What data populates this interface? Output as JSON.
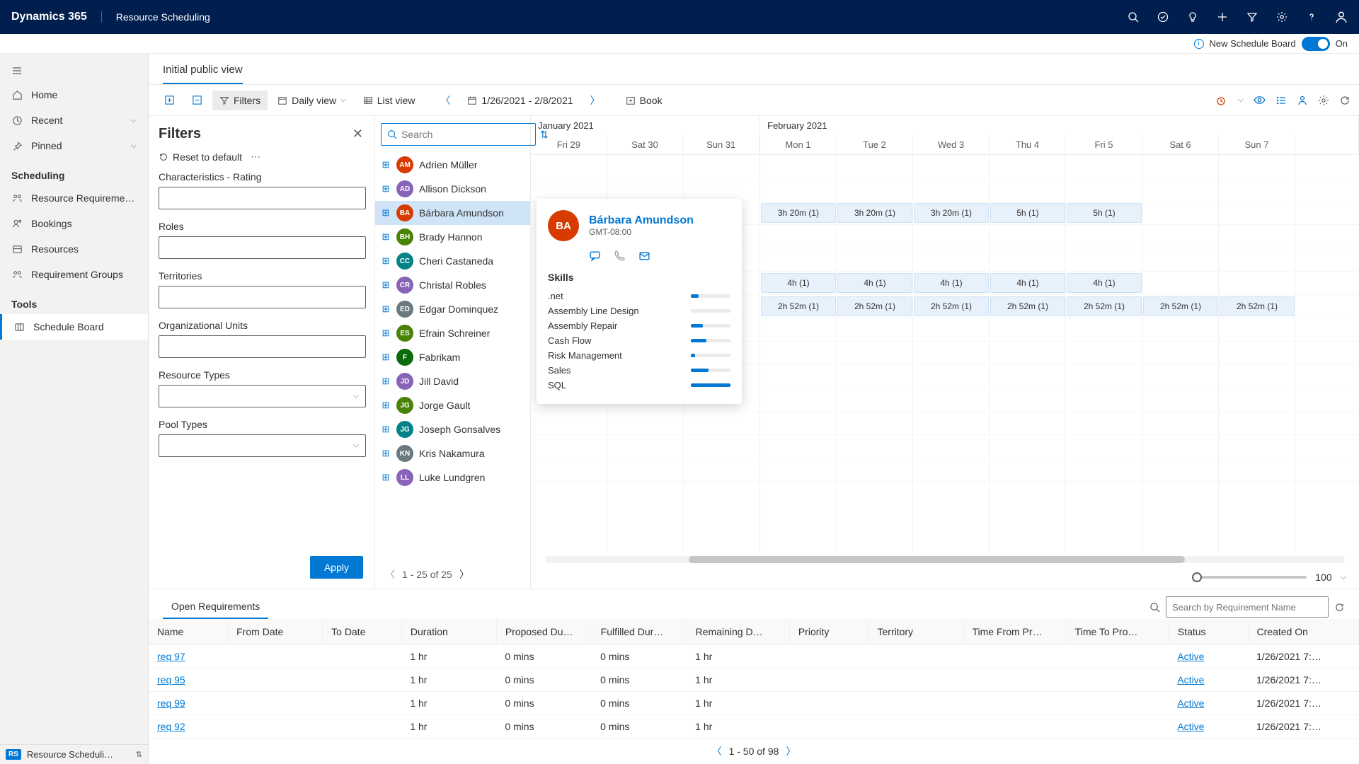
{
  "topbar": {
    "brand": "Dynamics 365",
    "module": "Resource Scheduling"
  },
  "newboard": {
    "label": "New Schedule Board",
    "state": "On"
  },
  "leftnav": {
    "home": "Home",
    "recent": "Recent",
    "pinned": "Pinned",
    "section_scheduling": "Scheduling",
    "resource_requirements": "Resource Requireme…",
    "bookings": "Bookings",
    "resources": "Resources",
    "requirement_groups": "Requirement Groups",
    "section_tools": "Tools",
    "schedule_board": "Schedule Board",
    "bottom": "Resource Scheduli…"
  },
  "viewtab": "Initial public view",
  "toolbar": {
    "filters": "Filters",
    "daily_view": "Daily view",
    "list_view": "List view",
    "date_range": "1/26/2021 - 2/8/2021",
    "book": "Book"
  },
  "filters": {
    "title": "Filters",
    "reset": "Reset to default",
    "characteristics": "Characteristics - Rating",
    "roles": "Roles",
    "territories": "Territories",
    "org_units": "Organizational Units",
    "resource_types": "Resource Types",
    "pool_types": "Pool Types",
    "apply": "Apply"
  },
  "resource_search": {
    "placeholder": "Search"
  },
  "resources": [
    {
      "name": "Adrien Müller",
      "initials": "AM",
      "color": "#d83b01"
    },
    {
      "name": "Allison Dickson",
      "initials": "AD",
      "color": "#8764b8"
    },
    {
      "name": "Bárbara Amundson",
      "initials": "BA",
      "color": "#d83b01",
      "selected": true
    },
    {
      "name": "Brady Hannon",
      "initials": "BH",
      "color": "#498205"
    },
    {
      "name": "Cheri Castaneda",
      "initials": "CC",
      "color": "#038387"
    },
    {
      "name": "Christal Robles",
      "initials": "CR",
      "color": "#8764b8"
    },
    {
      "name": "Edgar Dominquez",
      "initials": "ED",
      "color": "#69797e"
    },
    {
      "name": "Efrain Schreiner",
      "initials": "ES",
      "color": "#498205"
    },
    {
      "name": "Fabrikam",
      "initials": "F",
      "color": "#0b6a0b"
    },
    {
      "name": "Jill David",
      "initials": "JD",
      "color": "#8764b8"
    },
    {
      "name": "Jorge Gault",
      "initials": "JG",
      "color": "#498205"
    },
    {
      "name": "Joseph Gonsalves",
      "initials": "JG",
      "color": "#038387"
    },
    {
      "name": "Kris Nakamura",
      "initials": "KN",
      "color": "#69797e"
    },
    {
      "name": "Luke Lundgren",
      "initials": "LL",
      "color": "#8764b8"
    }
  ],
  "resource_pager": "1 - 25 of 25",
  "timeline": {
    "month1": "January 2021",
    "month2": "February 2021",
    "days_jan": [
      "Fri 29",
      "Sat 30",
      "Sun 31"
    ],
    "days_feb": [
      "Mon 1",
      "Tue 2",
      "Wed 3",
      "Thu 4",
      "Fri 5",
      "Sat 6",
      "Sun 7"
    ],
    "zoom_value": "100"
  },
  "bookings_row3": [
    "",
    "",
    "",
    "3h 20m (1)",
    "3h 20m (1)",
    "3h 20m (1)",
    "5h (1)",
    "5h (1)",
    "",
    ""
  ],
  "bookings_row6a": [
    "",
    "",
    "",
    "4h (1)",
    "4h (1)",
    "4h (1)",
    "4h (1)",
    "4h (1)",
    "",
    ""
  ],
  "bookings_row6b": [
    "",
    "",
    "",
    "2h 52m (1)",
    "2h 52m (1)",
    "2h 52m (1)",
    "2h 52m (1)",
    "2h 52m (1)",
    "2h 52m (1)",
    "2h 52m (1)"
  ],
  "card": {
    "name": "Bárbara Amundson",
    "initials": "BA",
    "tz": "GMT-08:00",
    "skills_title": "Skills",
    "skills": [
      {
        "name": ".net",
        "pct": 20
      },
      {
        "name": "Assembly Line Design",
        "pct": 0
      },
      {
        "name": "Assembly Repair",
        "pct": 30
      },
      {
        "name": "Cash Flow",
        "pct": 40
      },
      {
        "name": "Risk Management",
        "pct": 10
      },
      {
        "name": "Sales",
        "pct": 45
      },
      {
        "name": "SQL",
        "pct": 100
      }
    ]
  },
  "requirements": {
    "tab": "Open Requirements",
    "search_placeholder": "Search by Requirement Name",
    "columns": [
      "Name",
      "From Date",
      "To Date",
      "Duration",
      "Proposed Du…",
      "Fulfilled Dur…",
      "Remaining D…",
      "Priority",
      "Territory",
      "Time From Pr…",
      "Time To Pro…",
      "Status",
      "Created On"
    ],
    "rows": [
      {
        "name": "req 97",
        "duration": "1 hr",
        "proposed": "0 mins",
        "fulfilled": "0 mins",
        "remaining": "1 hr",
        "status": "Active",
        "created": "1/26/2021 7:…"
      },
      {
        "name": "req 95",
        "duration": "1 hr",
        "proposed": "0 mins",
        "fulfilled": "0 mins",
        "remaining": "1 hr",
        "status": "Active",
        "created": "1/26/2021 7:…"
      },
      {
        "name": "req 99",
        "duration": "1 hr",
        "proposed": "0 mins",
        "fulfilled": "0 mins",
        "remaining": "1 hr",
        "status": "Active",
        "created": "1/26/2021 7:…"
      },
      {
        "name": "req 92",
        "duration": "1 hr",
        "proposed": "0 mins",
        "fulfilled": "0 mins",
        "remaining": "1 hr",
        "status": "Active",
        "created": "1/26/2021 7:…"
      }
    ],
    "pager": "1 - 50 of 98"
  }
}
